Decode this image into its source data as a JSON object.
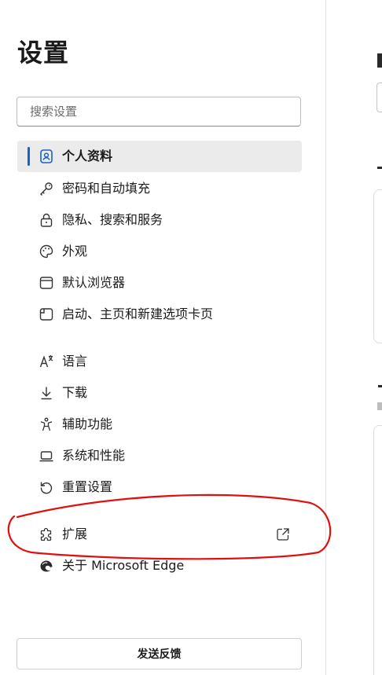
{
  "title": "设置",
  "search": {
    "placeholder": "搜索设置"
  },
  "nav": [
    {
      "label": "个人资料",
      "icon": "profile-icon",
      "selected": true
    },
    {
      "label": "密码和自动填充",
      "icon": "key-icon"
    },
    {
      "label": "隐私、搜索和服务",
      "icon": "lock-icon"
    },
    {
      "label": "外观",
      "icon": "palette-icon"
    },
    {
      "label": "默认浏览器",
      "icon": "browser-window-icon"
    },
    {
      "label": "启动、主页和新建选项卡页",
      "icon": "start-page-icon"
    },
    {
      "label": "语言",
      "icon": "language-icon"
    },
    {
      "label": "下载",
      "icon": "download-icon"
    },
    {
      "label": "辅助功能",
      "icon": "accessibility-icon"
    },
    {
      "label": "系统和性能",
      "icon": "laptop-icon"
    },
    {
      "label": "重置设置",
      "icon": "reset-icon"
    },
    {
      "label": "扩展",
      "icon": "puzzle-icon",
      "external_link_icon": "open-external-icon"
    },
    {
      "label": "关于 Microsoft Edge",
      "icon": "edge-logo-icon"
    }
  ],
  "feedback_label": "发送反馈",
  "colors": {
    "accent": "#1a62c9",
    "selected_bg": "#ebebeb",
    "annotation": "#e01010"
  }
}
